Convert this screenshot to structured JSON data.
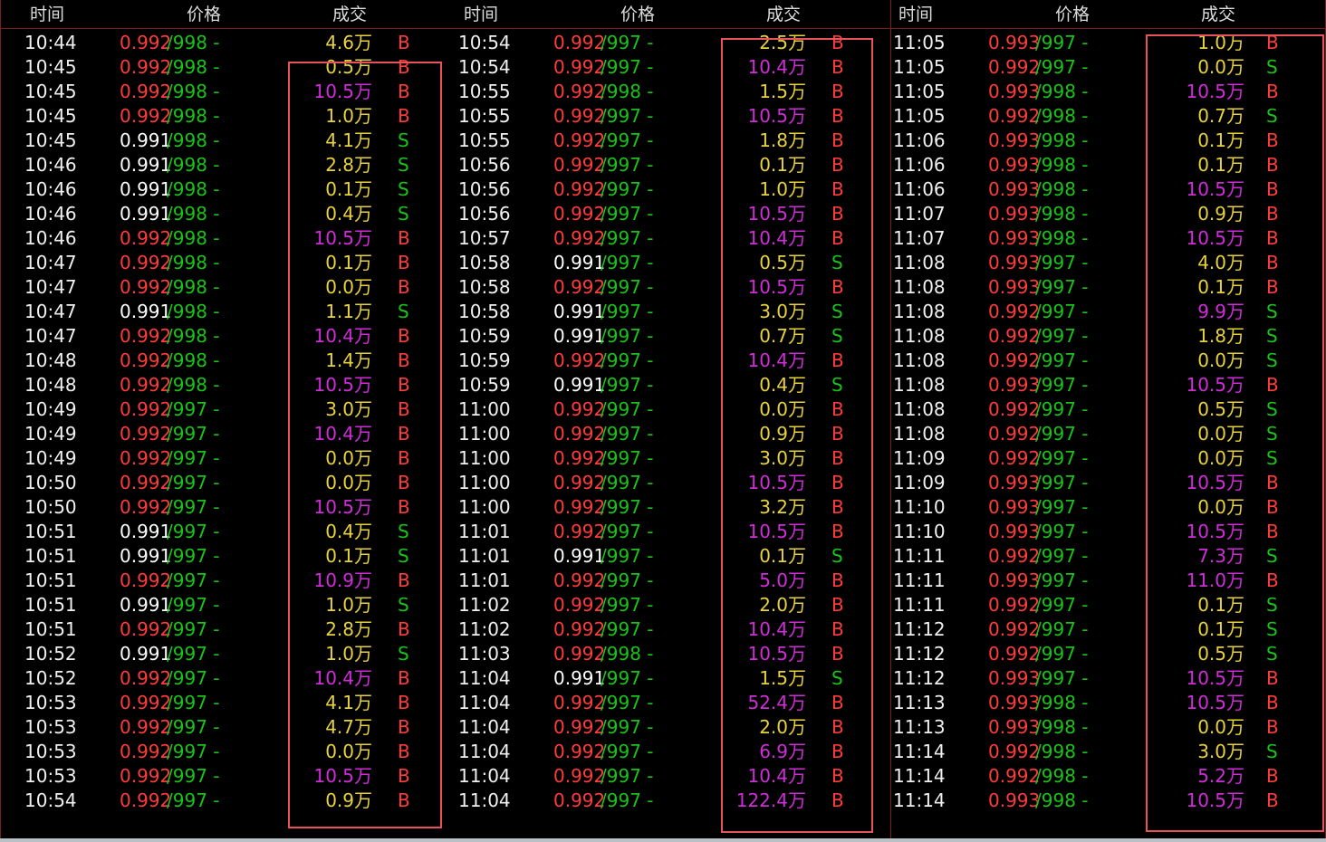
{
  "colors": {
    "price_up": "#ff3b3b",
    "price_flat": "#ffffff",
    "ask": "#18c418",
    "vol_normal": "#e8d23c",
    "vol_big": "#d12cd9",
    "dir_B": "#ff3b3b",
    "dir_S": "#18c418"
  },
  "headers": {
    "time": "时间",
    "price": "价格",
    "volume": "成交"
  },
  "panels": [
    {
      "rows": [
        {
          "time": "10:44",
          "price": "0.992",
          "ask": "/998 -",
          "vol": "4.6万",
          "dir": "B",
          "pc": "up",
          "vc": "normal"
        },
        {
          "time": "10:45",
          "price": "0.992",
          "ask": "/998 -",
          "vol": "0.5万",
          "dir": "B",
          "pc": "up",
          "vc": "normal"
        },
        {
          "time": "10:45",
          "price": "0.992",
          "ask": "/998 -",
          "vol": "10.5万",
          "dir": "B",
          "pc": "up",
          "vc": "big"
        },
        {
          "time": "10:45",
          "price": "0.992",
          "ask": "/998 -",
          "vol": "1.0万",
          "dir": "B",
          "pc": "up",
          "vc": "normal"
        },
        {
          "time": "10:45",
          "price": "0.991",
          "ask": "/998 -",
          "vol": "4.1万",
          "dir": "S",
          "pc": "flat",
          "vc": "normal"
        },
        {
          "time": "10:46",
          "price": "0.991",
          "ask": "/998 -",
          "vol": "2.8万",
          "dir": "S",
          "pc": "flat",
          "vc": "normal"
        },
        {
          "time": "10:46",
          "price": "0.991",
          "ask": "/998 -",
          "vol": "0.1万",
          "dir": "S",
          "pc": "flat",
          "vc": "normal"
        },
        {
          "time": "10:46",
          "price": "0.991",
          "ask": "/998 -",
          "vol": "0.4万",
          "dir": "S",
          "pc": "flat",
          "vc": "normal"
        },
        {
          "time": "10:46",
          "price": "0.992",
          "ask": "/998 -",
          "vol": "10.5万",
          "dir": "B",
          "pc": "up",
          "vc": "big"
        },
        {
          "time": "10:47",
          "price": "0.992",
          "ask": "/998 -",
          "vol": "0.1万",
          "dir": "B",
          "pc": "up",
          "vc": "normal"
        },
        {
          "time": "10:47",
          "price": "0.992",
          "ask": "/998 -",
          "vol": "0.0万",
          "dir": "B",
          "pc": "up",
          "vc": "normal"
        },
        {
          "time": "10:47",
          "price": "0.991",
          "ask": "/998 -",
          "vol": "1.1万",
          "dir": "S",
          "pc": "flat",
          "vc": "normal"
        },
        {
          "time": "10:47",
          "price": "0.992",
          "ask": "/998 -",
          "vol": "10.4万",
          "dir": "B",
          "pc": "up",
          "vc": "big"
        },
        {
          "time": "10:48",
          "price": "0.992",
          "ask": "/998 -",
          "vol": "1.4万",
          "dir": "B",
          "pc": "up",
          "vc": "normal"
        },
        {
          "time": "10:48",
          "price": "0.992",
          "ask": "/998 -",
          "vol": "10.5万",
          "dir": "B",
          "pc": "up",
          "vc": "big"
        },
        {
          "time": "10:49",
          "price": "0.992",
          "ask": "/997 -",
          "vol": "3.0万",
          "dir": "B",
          "pc": "up",
          "vc": "normal"
        },
        {
          "time": "10:49",
          "price": "0.992",
          "ask": "/997 -",
          "vol": "10.4万",
          "dir": "B",
          "pc": "up",
          "vc": "big"
        },
        {
          "time": "10:49",
          "price": "0.992",
          "ask": "/997 -",
          "vol": "0.0万",
          "dir": "B",
          "pc": "up",
          "vc": "normal"
        },
        {
          "time": "10:50",
          "price": "0.992",
          "ask": "/997 -",
          "vol": "0.0万",
          "dir": "B",
          "pc": "up",
          "vc": "normal"
        },
        {
          "time": "10:50",
          "price": "0.992",
          "ask": "/997 -",
          "vol": "10.5万",
          "dir": "B",
          "pc": "up",
          "vc": "big"
        },
        {
          "time": "10:51",
          "price": "0.991",
          "ask": "/997 -",
          "vol": "0.4万",
          "dir": "S",
          "pc": "flat",
          "vc": "normal"
        },
        {
          "time": "10:51",
          "price": "0.991",
          "ask": "/997 -",
          "vol": "0.1万",
          "dir": "S",
          "pc": "flat",
          "vc": "normal"
        },
        {
          "time": "10:51",
          "price": "0.992",
          "ask": "/997 -",
          "vol": "10.9万",
          "dir": "B",
          "pc": "up",
          "vc": "big"
        },
        {
          "time": "10:51",
          "price": "0.991",
          "ask": "/997 -",
          "vol": "1.0万",
          "dir": "S",
          "pc": "flat",
          "vc": "normal"
        },
        {
          "time": "10:51",
          "price": "0.992",
          "ask": "/997 -",
          "vol": "2.8万",
          "dir": "B",
          "pc": "up",
          "vc": "normal"
        },
        {
          "time": "10:52",
          "price": "0.991",
          "ask": "/997 -",
          "vol": "1.0万",
          "dir": "S",
          "pc": "flat",
          "vc": "normal"
        },
        {
          "time": "10:52",
          "price": "0.992",
          "ask": "/997 -",
          "vol": "10.4万",
          "dir": "B",
          "pc": "up",
          "vc": "big"
        },
        {
          "time": "10:53",
          "price": "0.992",
          "ask": "/997 -",
          "vol": "4.1万",
          "dir": "B",
          "pc": "up",
          "vc": "normal"
        },
        {
          "time": "10:53",
          "price": "0.992",
          "ask": "/997 -",
          "vol": "4.7万",
          "dir": "B",
          "pc": "up",
          "vc": "normal"
        },
        {
          "time": "10:53",
          "price": "0.992",
          "ask": "/997 -",
          "vol": "0.0万",
          "dir": "B",
          "pc": "up",
          "vc": "normal"
        },
        {
          "time": "10:53",
          "price": "0.992",
          "ask": "/997 -",
          "vol": "10.5万",
          "dir": "B",
          "pc": "up",
          "vc": "big"
        },
        {
          "time": "10:54",
          "price": "0.992",
          "ask": "/997 -",
          "vol": "0.9万",
          "dir": "B",
          "pc": "up",
          "vc": "normal"
        }
      ]
    },
    {
      "rows": [
        {
          "time": "10:54",
          "price": "0.992",
          "ask": "/997 -",
          "vol": "2.5万",
          "dir": "B",
          "pc": "up",
          "vc": "normal"
        },
        {
          "time": "10:54",
          "price": "0.992",
          "ask": "/997 -",
          "vol": "10.4万",
          "dir": "B",
          "pc": "up",
          "vc": "big"
        },
        {
          "time": "10:55",
          "price": "0.992",
          "ask": "/998 -",
          "vol": "1.5万",
          "dir": "B",
          "pc": "up",
          "vc": "normal"
        },
        {
          "time": "10:55",
          "price": "0.992",
          "ask": "/997 -",
          "vol": "10.5万",
          "dir": "B",
          "pc": "up",
          "vc": "big"
        },
        {
          "time": "10:55",
          "price": "0.992",
          "ask": "/997 -",
          "vol": "1.8万",
          "dir": "B",
          "pc": "up",
          "vc": "normal"
        },
        {
          "time": "10:56",
          "price": "0.992",
          "ask": "/997 -",
          "vol": "0.1万",
          "dir": "B",
          "pc": "up",
          "vc": "normal"
        },
        {
          "time": "10:56",
          "price": "0.992",
          "ask": "/997 -",
          "vol": "1.0万",
          "dir": "B",
          "pc": "up",
          "vc": "normal"
        },
        {
          "time": "10:56",
          "price": "0.992",
          "ask": "/997 -",
          "vol": "10.5万",
          "dir": "B",
          "pc": "up",
          "vc": "big"
        },
        {
          "time": "10:57",
          "price": "0.992",
          "ask": "/997 -",
          "vol": "10.4万",
          "dir": "B",
          "pc": "up",
          "vc": "big"
        },
        {
          "time": "10:58",
          "price": "0.991",
          "ask": "/997 -",
          "vol": "0.5万",
          "dir": "S",
          "pc": "flat",
          "vc": "normal"
        },
        {
          "time": "10:58",
          "price": "0.992",
          "ask": "/997 -",
          "vol": "10.5万",
          "dir": "B",
          "pc": "up",
          "vc": "big"
        },
        {
          "time": "10:58",
          "price": "0.991",
          "ask": "/997 -",
          "vol": "3.0万",
          "dir": "S",
          "pc": "flat",
          "vc": "normal"
        },
        {
          "time": "10:59",
          "price": "0.991",
          "ask": "/997 -",
          "vol": "0.7万",
          "dir": "S",
          "pc": "flat",
          "vc": "normal"
        },
        {
          "time": "10:59",
          "price": "0.992",
          "ask": "/997 -",
          "vol": "10.4万",
          "dir": "B",
          "pc": "up",
          "vc": "big"
        },
        {
          "time": "10:59",
          "price": "0.991",
          "ask": "/997 -",
          "vol": "0.4万",
          "dir": "S",
          "pc": "flat",
          "vc": "normal"
        },
        {
          "time": "11:00",
          "price": "0.992",
          "ask": "/997 -",
          "vol": "0.0万",
          "dir": "B",
          "pc": "up",
          "vc": "normal"
        },
        {
          "time": "11:00",
          "price": "0.992",
          "ask": "/997 -",
          "vol": "0.9万",
          "dir": "B",
          "pc": "up",
          "vc": "normal"
        },
        {
          "time": "11:00",
          "price": "0.992",
          "ask": "/997 -",
          "vol": "3.0万",
          "dir": "B",
          "pc": "up",
          "vc": "normal"
        },
        {
          "time": "11:00",
          "price": "0.992",
          "ask": "/997 -",
          "vol": "10.5万",
          "dir": "B",
          "pc": "up",
          "vc": "big"
        },
        {
          "time": "11:00",
          "price": "0.992",
          "ask": "/997 -",
          "vol": "3.2万",
          "dir": "B",
          "pc": "up",
          "vc": "normal"
        },
        {
          "time": "11:01",
          "price": "0.992",
          "ask": "/997 -",
          "vol": "10.5万",
          "dir": "B",
          "pc": "up",
          "vc": "big"
        },
        {
          "time": "11:01",
          "price": "0.991",
          "ask": "/997 -",
          "vol": "0.1万",
          "dir": "S",
          "pc": "flat",
          "vc": "normal"
        },
        {
          "time": "11:01",
          "price": "0.992",
          "ask": "/997 -",
          "vol": "5.0万",
          "dir": "B",
          "pc": "up",
          "vc": "big"
        },
        {
          "time": "11:02",
          "price": "0.992",
          "ask": "/997 -",
          "vol": "2.0万",
          "dir": "B",
          "pc": "up",
          "vc": "normal"
        },
        {
          "time": "11:02",
          "price": "0.992",
          "ask": "/997 -",
          "vol": "10.4万",
          "dir": "B",
          "pc": "up",
          "vc": "big"
        },
        {
          "time": "11:03",
          "price": "0.992",
          "ask": "/998 -",
          "vol": "10.5万",
          "dir": "B",
          "pc": "up",
          "vc": "big"
        },
        {
          "time": "11:04",
          "price": "0.991",
          "ask": "/997 -",
          "vol": "1.5万",
          "dir": "S",
          "pc": "flat",
          "vc": "normal"
        },
        {
          "time": "11:04",
          "price": "0.992",
          "ask": "/997 -",
          "vol": "52.4万",
          "dir": "B",
          "pc": "up",
          "vc": "big"
        },
        {
          "time": "11:04",
          "price": "0.992",
          "ask": "/997 -",
          "vol": "2.0万",
          "dir": "B",
          "pc": "up",
          "vc": "normal"
        },
        {
          "time": "11:04",
          "price": "0.992",
          "ask": "/997 -",
          "vol": "6.9万",
          "dir": "B",
          "pc": "up",
          "vc": "big"
        },
        {
          "time": "11:04",
          "price": "0.992",
          "ask": "/997 -",
          "vol": "10.4万",
          "dir": "B",
          "pc": "up",
          "vc": "big"
        },
        {
          "time": "11:04",
          "price": "0.992",
          "ask": "/997 -",
          "vol": "122.4万",
          "dir": "B",
          "pc": "up",
          "vc": "big"
        }
      ]
    },
    {
      "rows": [
        {
          "time": "11:05",
          "price": "0.993",
          "ask": "/997 -",
          "vol": "1.0万",
          "dir": "B",
          "pc": "up",
          "vc": "normal"
        },
        {
          "time": "11:05",
          "price": "0.992",
          "ask": "/997 -",
          "vol": "0.0万",
          "dir": "S",
          "pc": "up",
          "vc": "normal"
        },
        {
          "time": "11:05",
          "price": "0.993",
          "ask": "/998 -",
          "vol": "10.5万",
          "dir": "B",
          "pc": "up",
          "vc": "big"
        },
        {
          "time": "11:05",
          "price": "0.992",
          "ask": "/998 -",
          "vol": "0.7万",
          "dir": "S",
          "pc": "up",
          "vc": "normal"
        },
        {
          "time": "11:06",
          "price": "0.993",
          "ask": "/998 -",
          "vol": "0.1万",
          "dir": "B",
          "pc": "up",
          "vc": "normal"
        },
        {
          "time": "11:06",
          "price": "0.993",
          "ask": "/998 -",
          "vol": "0.1万",
          "dir": "B",
          "pc": "up",
          "vc": "normal"
        },
        {
          "time": "11:06",
          "price": "0.993",
          "ask": "/998 -",
          "vol": "10.5万",
          "dir": "B",
          "pc": "up",
          "vc": "big"
        },
        {
          "time": "11:07",
          "price": "0.993",
          "ask": "/998 -",
          "vol": "0.9万",
          "dir": "B",
          "pc": "up",
          "vc": "normal"
        },
        {
          "time": "11:07",
          "price": "0.993",
          "ask": "/998 -",
          "vol": "10.5万",
          "dir": "B",
          "pc": "up",
          "vc": "big"
        },
        {
          "time": "11:08",
          "price": "0.993",
          "ask": "/997 -",
          "vol": "4.0万",
          "dir": "B",
          "pc": "up",
          "vc": "normal"
        },
        {
          "time": "11:08",
          "price": "0.993",
          "ask": "/997 -",
          "vol": "0.1万",
          "dir": "B",
          "pc": "up",
          "vc": "normal"
        },
        {
          "time": "11:08",
          "price": "0.992",
          "ask": "/997 -",
          "vol": "9.9万",
          "dir": "S",
          "pc": "up",
          "vc": "big"
        },
        {
          "time": "11:08",
          "price": "0.992",
          "ask": "/997 -",
          "vol": "1.8万",
          "dir": "S",
          "pc": "up",
          "vc": "normal"
        },
        {
          "time": "11:08",
          "price": "0.992",
          "ask": "/997 -",
          "vol": "0.0万",
          "dir": "S",
          "pc": "up",
          "vc": "normal"
        },
        {
          "time": "11:08",
          "price": "0.993",
          "ask": "/997 -",
          "vol": "10.5万",
          "dir": "B",
          "pc": "up",
          "vc": "big"
        },
        {
          "time": "11:08",
          "price": "0.992",
          "ask": "/997 -",
          "vol": "0.5万",
          "dir": "S",
          "pc": "up",
          "vc": "normal"
        },
        {
          "time": "11:08",
          "price": "0.992",
          "ask": "/997 -",
          "vol": "0.0万",
          "dir": "S",
          "pc": "up",
          "vc": "normal"
        },
        {
          "time": "11:09",
          "price": "0.992",
          "ask": "/997 -",
          "vol": "0.0万",
          "dir": "S",
          "pc": "up",
          "vc": "normal"
        },
        {
          "time": "11:09",
          "price": "0.993",
          "ask": "/997 -",
          "vol": "10.5万",
          "dir": "B",
          "pc": "up",
          "vc": "big"
        },
        {
          "time": "11:10",
          "price": "0.993",
          "ask": "/997 -",
          "vol": "0.0万",
          "dir": "B",
          "pc": "up",
          "vc": "normal"
        },
        {
          "time": "11:10",
          "price": "0.993",
          "ask": "/997 -",
          "vol": "10.5万",
          "dir": "B",
          "pc": "up",
          "vc": "big"
        },
        {
          "time": "11:11",
          "price": "0.992",
          "ask": "/997 -",
          "vol": "7.3万",
          "dir": "S",
          "pc": "up",
          "vc": "big"
        },
        {
          "time": "11:11",
          "price": "0.993",
          "ask": "/997 -",
          "vol": "11.0万",
          "dir": "B",
          "pc": "up",
          "vc": "big"
        },
        {
          "time": "11:11",
          "price": "0.992",
          "ask": "/997 -",
          "vol": "0.1万",
          "dir": "S",
          "pc": "up",
          "vc": "normal"
        },
        {
          "time": "11:12",
          "price": "0.992",
          "ask": "/997 -",
          "vol": "0.1万",
          "dir": "S",
          "pc": "up",
          "vc": "normal"
        },
        {
          "time": "11:12",
          "price": "0.992",
          "ask": "/997 -",
          "vol": "0.5万",
          "dir": "S",
          "pc": "up",
          "vc": "normal"
        },
        {
          "time": "11:12",
          "price": "0.993",
          "ask": "/997 -",
          "vol": "10.5万",
          "dir": "B",
          "pc": "up",
          "vc": "big"
        },
        {
          "time": "11:13",
          "price": "0.993",
          "ask": "/998 -",
          "vol": "10.5万",
          "dir": "B",
          "pc": "up",
          "vc": "big"
        },
        {
          "time": "11:13",
          "price": "0.993",
          "ask": "/998 -",
          "vol": "0.0万",
          "dir": "B",
          "pc": "up",
          "vc": "normal"
        },
        {
          "time": "11:14",
          "price": "0.992",
          "ask": "/998 -",
          "vol": "3.0万",
          "dir": "S",
          "pc": "up",
          "vc": "normal"
        },
        {
          "time": "11:14",
          "price": "0.992",
          "ask": "/998 -",
          "vol": "5.2万",
          "dir": "B",
          "pc": "up",
          "vc": "big"
        },
        {
          "time": "11:14",
          "price": "0.993",
          "ask": "/998 -",
          "vol": "10.5万",
          "dir": "B",
          "pc": "up",
          "vc": "big"
        }
      ]
    }
  ]
}
